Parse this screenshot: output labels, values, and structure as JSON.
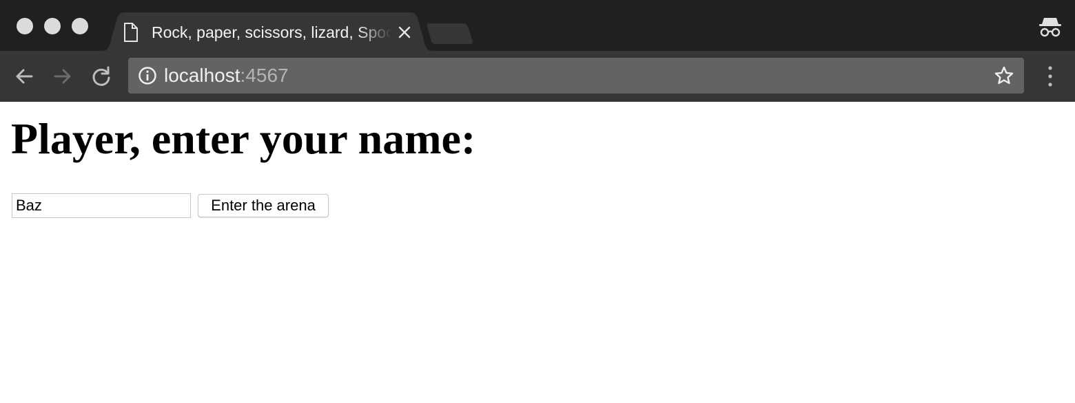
{
  "browser": {
    "tab": {
      "title": "Rock, paper, scissors, lizard, Spock",
      "icon": "document-icon"
    },
    "address_bar": {
      "host": "localhost",
      "port": ":4567"
    },
    "icons": {
      "back": "arrow-left-icon",
      "forward": "arrow-right-icon",
      "reload": "reload-icon",
      "info": "info-icon",
      "bookmark": "star-icon",
      "menu": "kebab-menu-icon",
      "close_tab": "close-icon",
      "incognito": "incognito-icon"
    },
    "colors": {
      "tabstrip": "#202020",
      "toolbar": "#363636",
      "omnibox": "#636363"
    }
  },
  "page": {
    "heading": "Player, enter your name:",
    "name_input": {
      "value": "Baz"
    },
    "submit_label": "Enter the arena"
  }
}
